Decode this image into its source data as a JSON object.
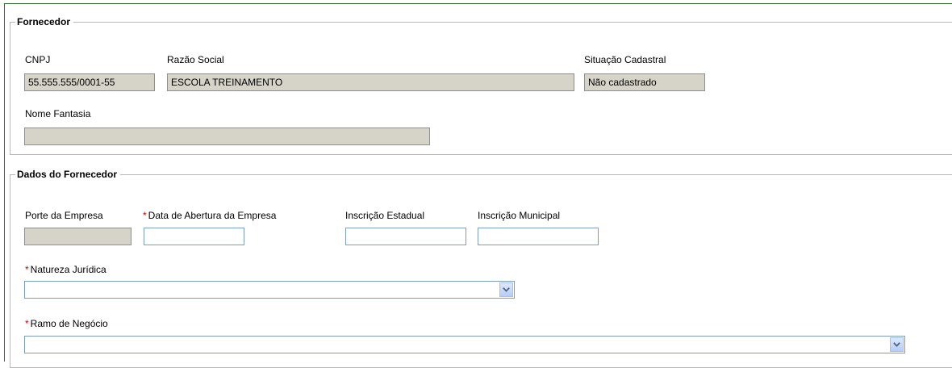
{
  "fornecedor": {
    "title": "Fornecedor",
    "cnpj_label": "CNPJ",
    "cnpj_value": "55.555.555/0001-55",
    "razao_label": "Razão Social",
    "razao_value": "ESCOLA TREINAMENTO",
    "situacao_label": "Situação Cadastral",
    "situacao_value": "Não cadastrado",
    "nome_fantasia_label": "Nome Fantasia",
    "nome_fantasia_value": ""
  },
  "dados": {
    "title": "Dados do Fornecedor",
    "porte_label": "Porte da Empresa",
    "porte_value": "",
    "required_mark": "*",
    "data_abertura_label": "Data de Abertura da Empresa",
    "data_abertura_value": "",
    "insc_estadual_label": "Inscrição Estadual",
    "insc_estadual_value": "",
    "insc_municipal_label": "Inscrição Municipal",
    "insc_municipal_value": "",
    "natureza_label": "Natureza Jurídica",
    "natureza_value": "",
    "ramo_label": "Ramo de Negócio",
    "ramo_value": ""
  },
  "icons": {
    "dropdown": "chevron-down-icon"
  }
}
